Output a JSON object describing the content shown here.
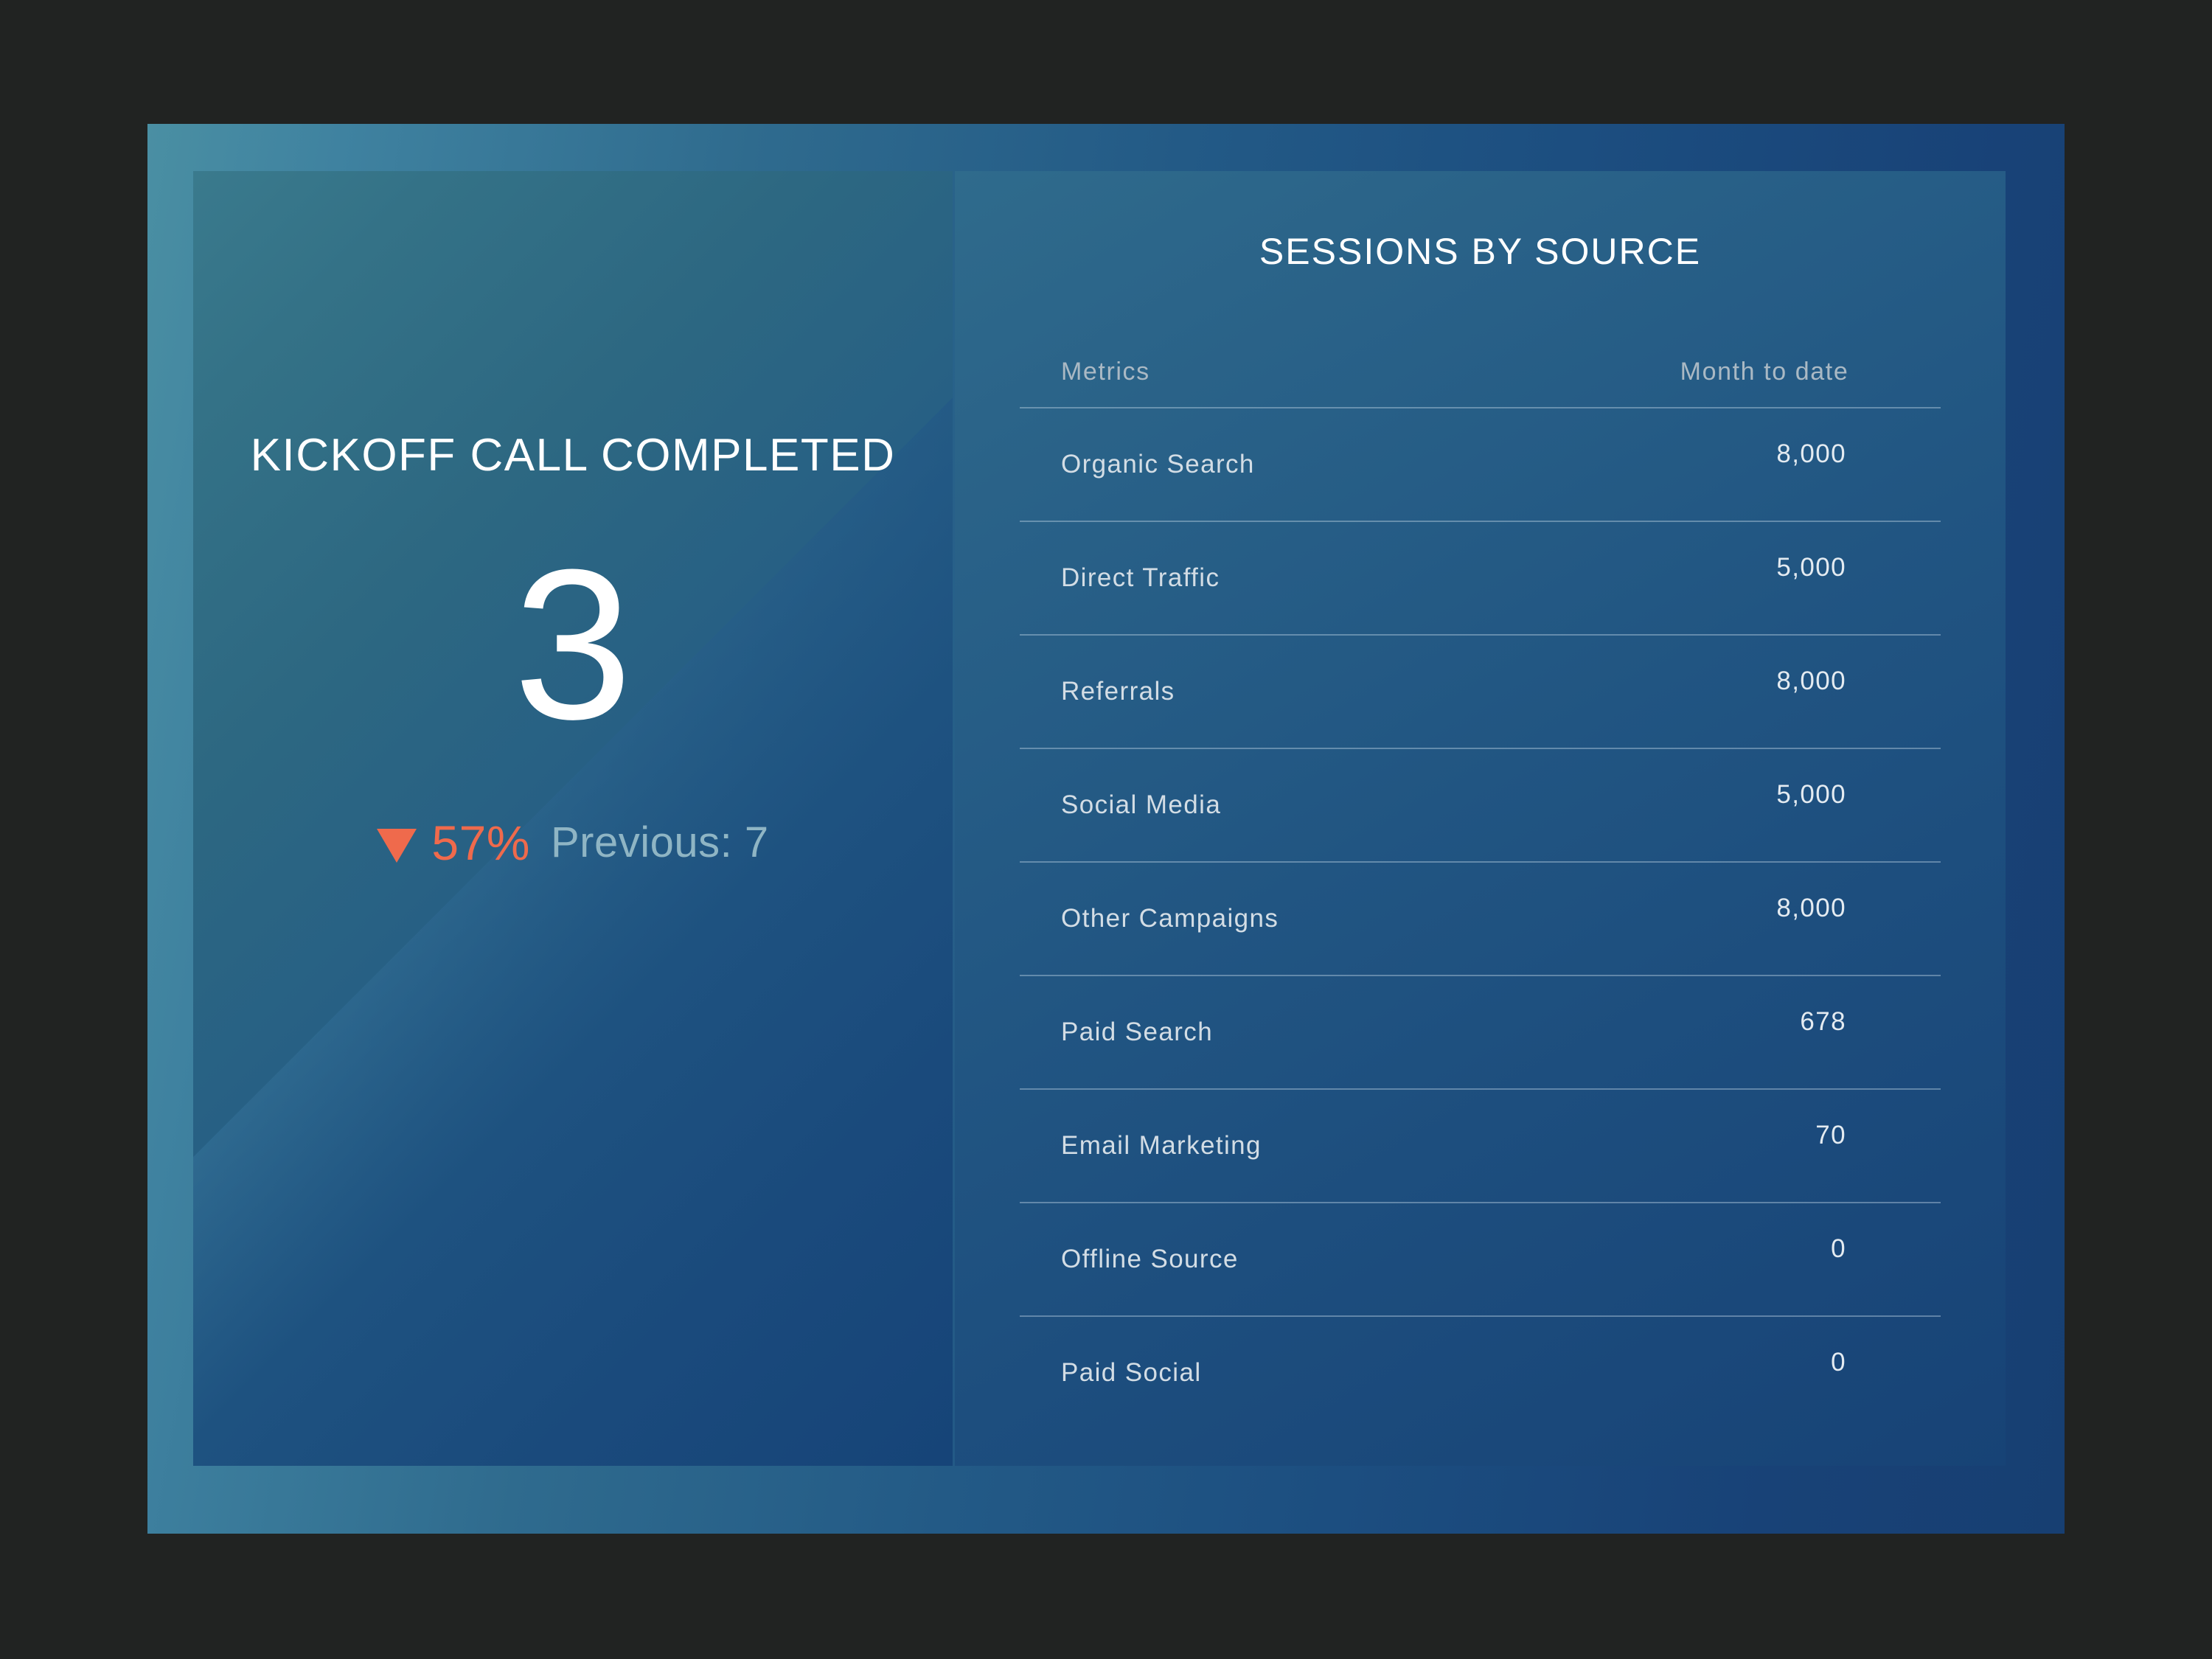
{
  "kpi_card": {
    "title": "KICKOFF CALL COMPLETED",
    "value": "3",
    "delta_icon": "triangle-down-icon",
    "delta_percent": "57%",
    "previous_label": "Previous:  7",
    "delta_color": "#ef6a4c",
    "previous_color": "#8fb5c4"
  },
  "table_card": {
    "title": "SESSIONS BY SOURCE",
    "columns": [
      "Metrics",
      "Month to date"
    ],
    "rows": [
      {
        "metric": "Organic Search",
        "value": "8,000"
      },
      {
        "metric": "Direct Traffic",
        "value": "5,000"
      },
      {
        "metric": "Referrals",
        "value": "8,000"
      },
      {
        "metric": "Social Media",
        "value": "5,000"
      },
      {
        "metric": "Other Campaigns",
        "value": "8,000"
      },
      {
        "metric": "Paid Search",
        "value": "678"
      },
      {
        "metric": "Email Marketing",
        "value": "70"
      },
      {
        "metric": "Offline Source",
        "value": "0"
      },
      {
        "metric": "Paid Social",
        "value": "0"
      }
    ]
  },
  "chart_data": {
    "type": "table",
    "title": "SESSIONS BY SOURCE",
    "columns": [
      "Metrics",
      "Month to date"
    ],
    "categories": [
      "Organic Search",
      "Direct Traffic",
      "Referrals",
      "Social Media",
      "Other Campaigns",
      "Paid Search",
      "Email Marketing",
      "Offline Source",
      "Paid Social"
    ],
    "values": [
      8000,
      5000,
      8000,
      5000,
      8000,
      678,
      70,
      0,
      0
    ],
    "xlabel": "Metrics",
    "ylabel": "Month to date"
  },
  "theme": {
    "page_background": "#212322",
    "frame_gradient_start": "#4a8fa3",
    "frame_gradient_end": "#173f72",
    "card_left_start": "#3a7a8d",
    "card_left_end": "#164478",
    "card_right_start": "#2f6b8c",
    "card_right_end": "#174376",
    "divider_color": "#bed4e4",
    "text_primary": "#ffffff",
    "text_muted": "#aab9c4",
    "accent_negative": "#ef6a4c"
  }
}
